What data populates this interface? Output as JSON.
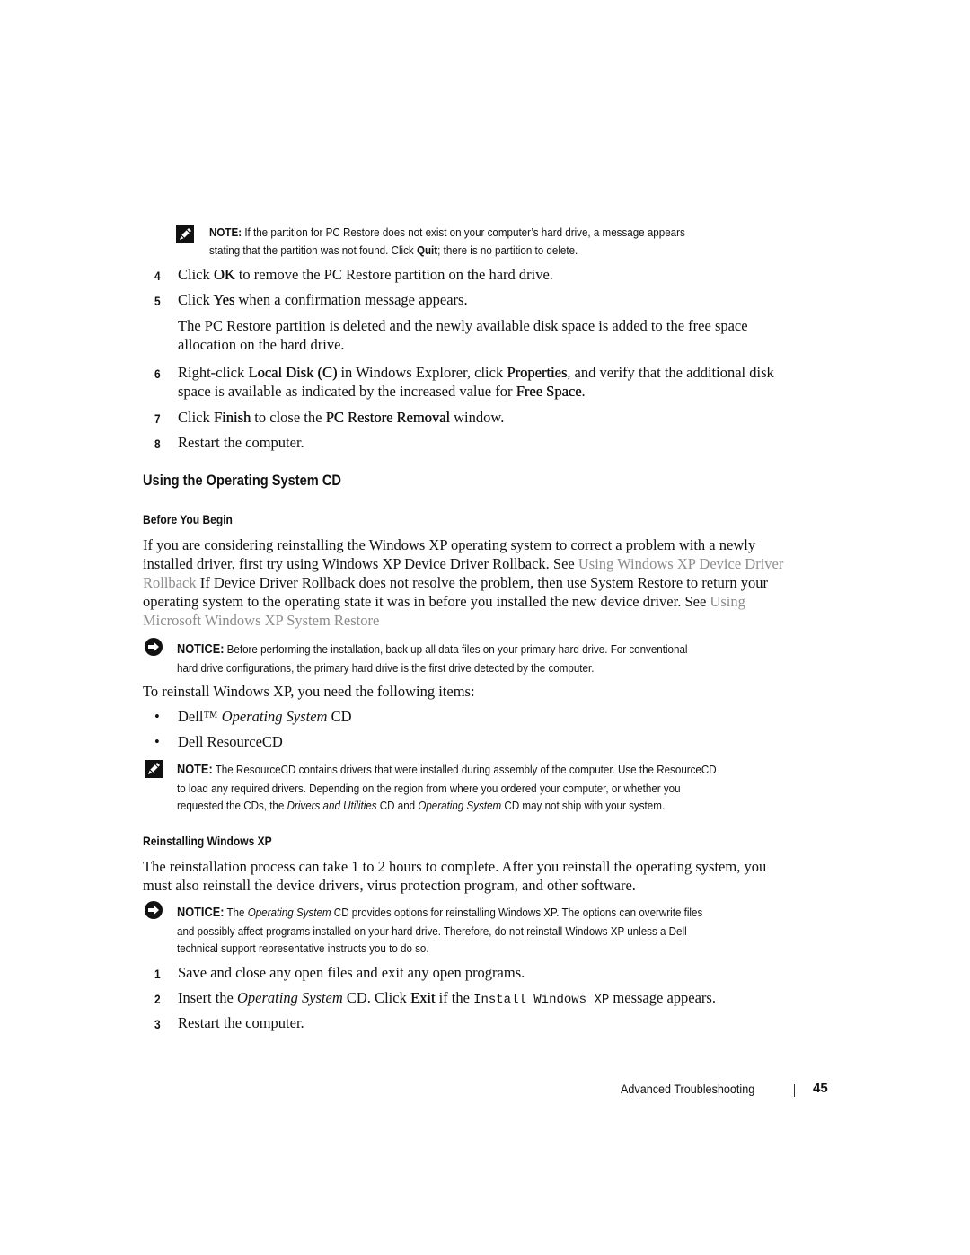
{
  "note1": {
    "label": "NOTE:",
    "text_a": " If the partition for PC Restore does not exist on your computer’s hard drive, a message appears",
    "text_b": "stating that the partition was not found. Click ",
    "bold_b": "Quit",
    "text_c": "; there is no partition to delete."
  },
  "steps_a": [
    {
      "num": "4",
      "parts": [
        "Click ",
        "OK",
        " to remove the PC Restore partition on the hard drive."
      ]
    },
    {
      "num": "5",
      "parts": [
        "Click ",
        "Yes",
        " when a confirmation message appears."
      ]
    }
  ],
  "step5_para": {
    "line1": "The PC Restore partition is deleted and the newly available disk space is added to the free space",
    "line2": "allocation on the hard drive."
  },
  "step6": {
    "num": "6",
    "l1a": "Right-click ",
    "l1b": "Local Disk (C)",
    "l1c": " in Windows Explorer, click ",
    "l1d": "Properties",
    "l1e": ", and verify that the additional disk",
    "l2a": "space is available as indicated by the increased value for ",
    "l2b": "Free Space",
    "l2c": "."
  },
  "step7": {
    "num": "7",
    "a": "Click ",
    "b": "Finish",
    "c": " to close the ",
    "d": "PC Restore Removal",
    "e": " window."
  },
  "step8": {
    "num": "8",
    "text": "Restart the computer."
  },
  "section_title": "Using the Operating System CD",
  "before_heading": "Before You Begin",
  "before_para": {
    "l1": "If you are considering reinstalling the Windows XP operating system to correct a problem with a newly",
    "l2a": "installed driver, first try using Windows XP Device Driver Rollback. See ",
    "l2link": "Using Windows XP Device Driver",
    "l3link": "Rollback",
    "l3b": " If Device Driver Rollback does not resolve the problem, then use System Restore to return your",
    "l4a": "operating system to the operating state it was in before you installed the new device driver. See ",
    "l4link": "Using",
    "l5link": "Microsoft Windows XP System Restore"
  },
  "notice1": {
    "label": "NOTICE:",
    "l1": " Before performing the installation, back up all data files on your primary hard drive. For conventional",
    "l2": "hard drive configurations, the primary hard drive is the first drive detected by the computer."
  },
  "items_intro": "To reinstall Windows XP, you need the following items:",
  "items": [
    {
      "a": "Dell™ ",
      "i": "Operating System",
      "b": " CD"
    },
    {
      "a": "Dell ResourceCD",
      "i": "",
      "b": ""
    }
  ],
  "bullet_char": "•",
  "note2": {
    "label": "NOTE:",
    "l1": " The ResourceCD contains drivers that were installed during assembly of the computer. Use the ResourceCD",
    "l2": "to load any required drivers. Depending on the region from where you ordered your computer, or whether you",
    "l3a": "requested the CDs, the ",
    "l3i": "Drivers and Utilities",
    "l3b": " CD and ",
    "l3i2": "Operating System",
    "l3c": " CD may not ship with your system."
  },
  "reinstall_heading": "Reinstalling Windows XP",
  "reinstall_para": {
    "l1": "The reinstallation process can take 1 to 2 hours to complete. After you reinstall the operating system, you",
    "l2": "must also reinstall the device drivers, virus protection program, and other software."
  },
  "notice2": {
    "label": "NOTICE:",
    "l1a": " The ",
    "l1i": "Operating System",
    "l1b": " CD provides options for reinstalling Windows XP. The options can overwrite files",
    "l2": "and possibly affect programs installed on your hard drive. Therefore, do not reinstall Windows XP unless a Dell",
    "l3": "technical support representative instructs you to do so."
  },
  "steps_b": {
    "s1": {
      "num": "1",
      "text": "Save and close any open files and exit any open programs."
    },
    "s2": {
      "num": "2",
      "a": "Insert the ",
      "i": "Operating System",
      "b": " CD. Click ",
      "bold": "Exit",
      "c": " if the ",
      "mono": "Install Windows XP",
      "d": " message appears."
    },
    "s3": {
      "num": "3",
      "text": "Restart the computer."
    }
  },
  "footer": {
    "section": "Advanced Troubleshooting",
    "page": "45"
  },
  "icons": {
    "note": "pencil-note-icon",
    "notice": "arrow-circle-notice-icon"
  }
}
